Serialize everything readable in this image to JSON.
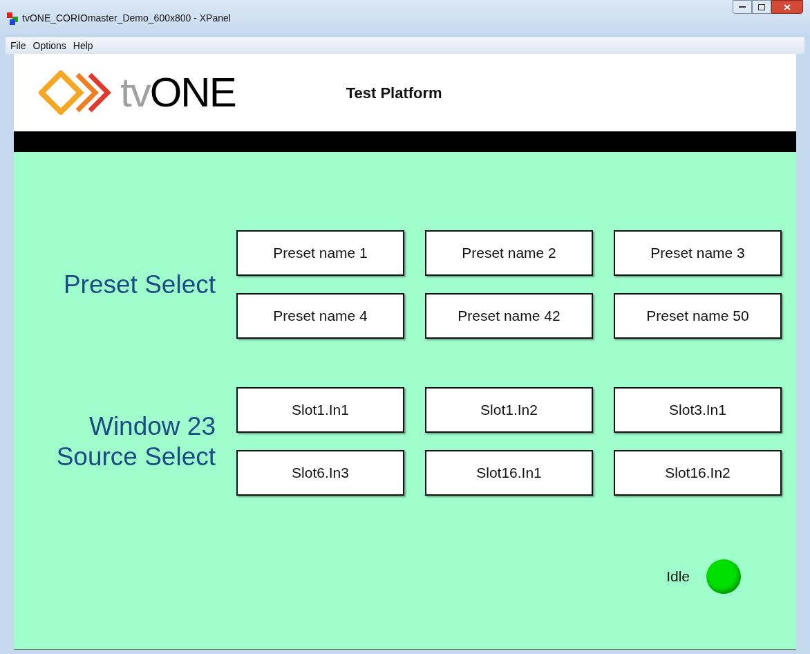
{
  "window": {
    "title": "tvONE_CORIOmaster_Demo_600x800 - XPanel"
  },
  "menu": [
    "File",
    "Options",
    "Help"
  ],
  "header": {
    "logo": {
      "light": "tv",
      "dark": "ONE"
    },
    "title": "Test Platform"
  },
  "groups": [
    {
      "label_lines": [
        "Preset Select"
      ],
      "buttons": [
        "Preset name 1",
        "Preset name 2",
        "Preset name 3",
        "Preset name 4",
        "Preset name 42",
        "Preset name 50"
      ]
    },
    {
      "label_lines": [
        "Window 23",
        "Source Select"
      ],
      "buttons": [
        "Slot1.In1",
        "Slot1.In2",
        "Slot3.In1",
        "Slot6.In3",
        "Slot16.In1",
        "Slot16.In2"
      ]
    }
  ],
  "status": {
    "label": "Idle",
    "color": "#00e000"
  }
}
